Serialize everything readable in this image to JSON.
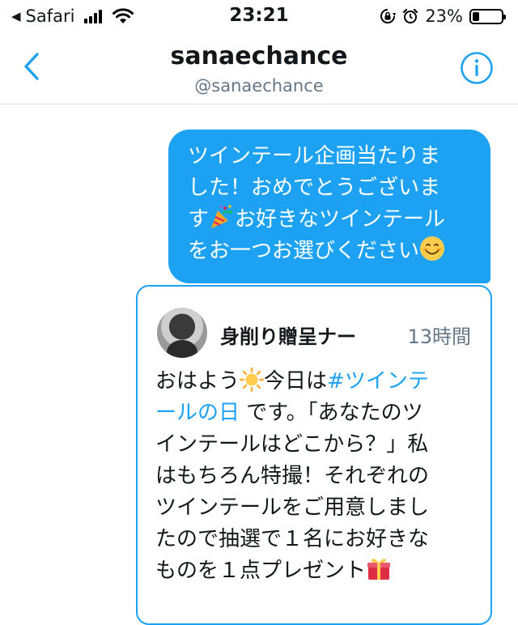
{
  "status_bar": {
    "back_app": "Safari",
    "time": "23:21",
    "battery_percent": "23%",
    "battery_level": 0.23,
    "back_arrow_glyph": "◀",
    "icons": [
      "signal-icon",
      "wifi-icon",
      "rotation-lock-icon",
      "alarm-icon",
      "battery-icon"
    ]
  },
  "header": {
    "title": "sanaechance",
    "handle": "@sanaechance",
    "back_icon": "chevron-left-icon",
    "info_icon": "info-icon",
    "accent_color": "#1da1f2"
  },
  "message": {
    "lines": [
      "ツインテール企画当たりま",
      "した！おめでとうございま",
      "す",
      "お好きなツインテール",
      "をお一つお選びください"
    ],
    "emojis": [
      "party-popper-emoji",
      "smiling-face-emoji"
    ],
    "bubble_color": "#1da1f2"
  },
  "quote": {
    "author": "身削り贈呈ナー",
    "time": "13時間",
    "line1_a": "おはよう",
    "line1_b": "今日は",
    "hashtag_1": "#ツインテ",
    "hashtag_2": "ールの日",
    "line2_rest": " です。「あなたのツ",
    "lines": [
      "インテールはどこから？」私",
      "はもちろん特撮！それぞれの",
      "ツインテールをご用意しまし",
      "たので抽選で１名にお好きな",
      "ものを１点プレゼント"
    ],
    "emojis": [
      "sun-emoji",
      "gift-emoji"
    ]
  }
}
